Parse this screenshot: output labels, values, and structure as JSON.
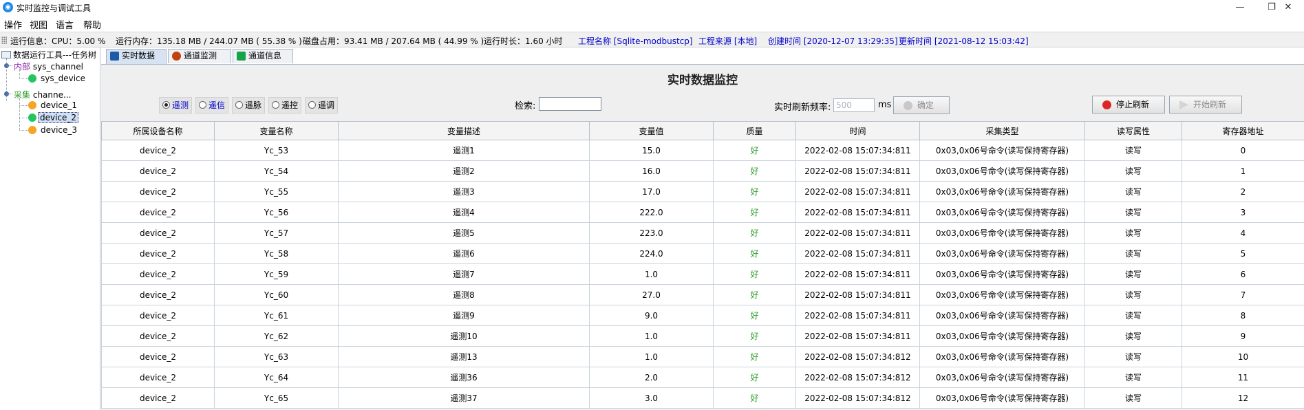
{
  "window": {
    "title": "实时监控与调试工具",
    "minimize": "—",
    "restore": "❐",
    "close": "✕"
  },
  "menu": [
    "操作",
    "视图",
    "语言",
    "帮助"
  ],
  "status": {
    "cpu": "运行信息：CPU：5.00 %",
    "memory": "运行内存：135.18 MB / 244.07 MB ( 55.38 % )",
    "disk": "磁盘占用：93.41 MB / 207.64 MB ( 44.99 % )",
    "uptime": "运行时长：1.60 小时",
    "project_name": "工程名称 [Sqlite-modbustcp]",
    "project_source": "工程来源 [本地]",
    "created": "创建时间 [2020-12-07 13:29:35]",
    "updated": "更新时间 [2021-08-12 15:03:42]"
  },
  "tree": {
    "root": "数据运行工具---任务树",
    "internal_tag": "内部",
    "internal_channel": "sys_channel",
    "internal_device": "sys_device",
    "collect_tag": "采集",
    "collect_channel": "channe...",
    "devices": [
      "device_1",
      "device_2",
      "device_3"
    ]
  },
  "tabs": [
    "实时数据",
    "通道监测",
    "通道信息"
  ],
  "panel": {
    "title": "实时数据监控",
    "radios": [
      "遥测",
      "遥信",
      "遥脉",
      "遥控",
      "遥调"
    ],
    "search_label": "检索:",
    "search_value": "",
    "refresh_label": "实时刷新频率:",
    "refresh_value": "500",
    "refresh_unit": "ms",
    "confirm_btn": "确定",
    "stop_btn": "停止刷新",
    "start_btn": "开始刷新"
  },
  "table": {
    "headers": [
      "所属设备名称",
      "变量名称",
      "变量描述",
      "变量值",
      "质量",
      "时间",
      "采集类型",
      "读写属性",
      "寄存器地址"
    ],
    "rows": [
      [
        "device_2",
        "Yc_53",
        "遥测1",
        "15.0",
        "好",
        "2022-02-08 15:07:34:811",
        "0x03,0x06号命令(读写保持寄存器)",
        "读写",
        "0"
      ],
      [
        "device_2",
        "Yc_54",
        "遥测2",
        "16.0",
        "好",
        "2022-02-08 15:07:34:811",
        "0x03,0x06号命令(读写保持寄存器)",
        "读写",
        "1"
      ],
      [
        "device_2",
        "Yc_55",
        "遥测3",
        "17.0",
        "好",
        "2022-02-08 15:07:34:811",
        "0x03,0x06号命令(读写保持寄存器)",
        "读写",
        "2"
      ],
      [
        "device_2",
        "Yc_56",
        "遥测4",
        "222.0",
        "好",
        "2022-02-08 15:07:34:811",
        "0x03,0x06号命令(读写保持寄存器)",
        "读写",
        "3"
      ],
      [
        "device_2",
        "Yc_57",
        "遥测5",
        "223.0",
        "好",
        "2022-02-08 15:07:34:811",
        "0x03,0x06号命令(读写保持寄存器)",
        "读写",
        "4"
      ],
      [
        "device_2",
        "Yc_58",
        "遥测6",
        "224.0",
        "好",
        "2022-02-08 15:07:34:811",
        "0x03,0x06号命令(读写保持寄存器)",
        "读写",
        "5"
      ],
      [
        "device_2",
        "Yc_59",
        "遥测7",
        "1.0",
        "好",
        "2022-02-08 15:07:34:811",
        "0x03,0x06号命令(读写保持寄存器)",
        "读写",
        "6"
      ],
      [
        "device_2",
        "Yc_60",
        "遥测8",
        "27.0",
        "好",
        "2022-02-08 15:07:34:811",
        "0x03,0x06号命令(读写保持寄存器)",
        "读写",
        "7"
      ],
      [
        "device_2",
        "Yc_61",
        "遥测9",
        "9.0",
        "好",
        "2022-02-08 15:07:34:811",
        "0x03,0x06号命令(读写保持寄存器)",
        "读写",
        "8"
      ],
      [
        "device_2",
        "Yc_62",
        "遥测10",
        "1.0",
        "好",
        "2022-02-08 15:07:34:811",
        "0x03,0x06号命令(读写保持寄存器)",
        "读写",
        "9"
      ],
      [
        "device_2",
        "Yc_63",
        "遥测13",
        "1.0",
        "好",
        "2022-02-08 15:07:34:812",
        "0x03,0x06号命令(读写保持寄存器)",
        "读写",
        "10"
      ],
      [
        "device_2",
        "Yc_64",
        "遥测36",
        "2.0",
        "好",
        "2022-02-08 15:07:34:812",
        "0x03,0x06号命令(读写保持寄存器)",
        "读写",
        "11"
      ],
      [
        "device_2",
        "Yc_65",
        "遥测37",
        "3.0",
        "好",
        "2022-02-08 15:07:34:812",
        "0x03,0x06号命令(读写保持寄存器)",
        "读写",
        "12"
      ]
    ]
  }
}
